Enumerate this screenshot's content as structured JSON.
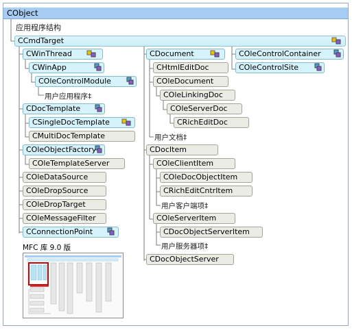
{
  "root": "CObject",
  "subtitle": "应用程序结构",
  "cmdtarget": "CCmdTarget",
  "col1": {
    "winthread": "CWinThread",
    "winapp": "CWinApp",
    "olecontrolmodule": "COleControlModule",
    "userapp": "用户应用程序‡",
    "doctemplate": "CDocTemplate",
    "singledoc": "CSingleDocTemplate",
    "multidoc": "CMultiDocTemplate",
    "objectfactory": "COleObjectFactory",
    "templateserver": "COleTemplateServer",
    "datasource": "COleDataSource",
    "dropsource": "COleDropSource",
    "droptarget": "COleDropTarget",
    "messagefilter": "COleMessageFilter",
    "connpoint": "CConnectionPoint"
  },
  "col2": {
    "document": "CDocument",
    "htmleditdoc": "CHtmlEditDoc",
    "oledocument": "COleDocument",
    "linkingdoc": "COleLinkingDoc",
    "serverdoc": "COleServerDoc",
    "richeditdoc": "CRichEditDoc",
    "userdoc": "用户文档‡",
    "docitem": "CDocItem",
    "clientitem": "COleClientItem",
    "docobjectitem": "COleDocObjectItem",
    "richeditcntritem": "CRichEditCntrItem",
    "userclientitem": "用户客户端项‡",
    "serveritem": "COleServerItem",
    "docobjectserveritem": "CDocObjectServerItem",
    "userserveritem": "用户服务器项‡",
    "docobjectserver": "CDocObjectServer"
  },
  "col3": {
    "controlcontainer": "COleControlContainer",
    "controlsite": "COleControlSite"
  },
  "minimap_label": "MFC 库 9.0 版",
  "colors": {
    "cyan": "#d6f2fb",
    "gray": "#ecece7",
    "header": "#a8cdf4",
    "highlight": "#cc0000"
  }
}
